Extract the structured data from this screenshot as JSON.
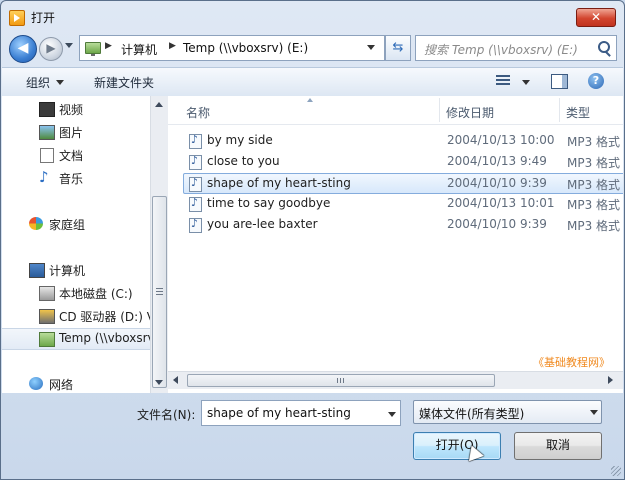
{
  "window": {
    "title": "打开",
    "close_glyph": "✕"
  },
  "nav": {
    "back_glyph": "◀",
    "forward_glyph": "▶",
    "breadcrumb": [
      "计算机",
      "Temp (\\\\vboxsrv) (E:)"
    ],
    "breadcrumb_sep": "▶",
    "refresh_glyph": "⇆",
    "search_placeholder": "搜索 Temp (\\\\vboxsrv) (E:)"
  },
  "toolbar": {
    "organize": "组织",
    "new_folder": "新建文件夹",
    "help_glyph": "?"
  },
  "sidebar": {
    "items": [
      {
        "label": "视频",
        "icon": "video-library-icon"
      },
      {
        "label": "图片",
        "icon": "pictures-library-icon"
      },
      {
        "label": "文档",
        "icon": "documents-library-icon"
      },
      {
        "label": "音乐",
        "icon": "music-library-icon"
      },
      {
        "label": "家庭组",
        "icon": "homegroup-icon"
      },
      {
        "label": "计算机",
        "icon": "computer-icon"
      },
      {
        "label": "本地磁盘 (C:)",
        "icon": "local-disk-icon"
      },
      {
        "label": "CD 驱动器 (D:) V",
        "icon": "cd-drive-icon"
      },
      {
        "label": "Temp (\\\\vboxsrv",
        "icon": "network-drive-icon",
        "selected": true
      },
      {
        "label": "网络",
        "icon": "network-icon"
      }
    ]
  },
  "file_list": {
    "columns": [
      "名称",
      "修改日期",
      "类型"
    ],
    "rows": [
      {
        "name": "by my side",
        "date": "2004/10/13 10:00",
        "type": "MP3 格式"
      },
      {
        "name": "close to you",
        "date": "2004/10/13 9:49",
        "type": "MP3 格式"
      },
      {
        "name": "shape of my heart-sting",
        "date": "2004/10/10 9:39",
        "type": "MP3 格式",
        "selected": true
      },
      {
        "name": "time to say goodbye",
        "date": "2004/10/13 10:01",
        "type": "MP3 格式"
      },
      {
        "name": "you are-lee baxter",
        "date": "2004/10/10 9:39",
        "type": "MP3 格式"
      }
    ]
  },
  "watermark": "《基础教程网》",
  "bottom": {
    "filename_label": "文件名(N):",
    "filename_value": "shape of my heart-sting",
    "filetype_value": "媒体文件(所有类型)",
    "open_button": "打开(O)",
    "cancel_button": "取消"
  },
  "colors": {
    "accent": "#3c7fb1",
    "selection": "#d7e8fb",
    "close": "#c0331f",
    "watermark": "#f08a20"
  }
}
